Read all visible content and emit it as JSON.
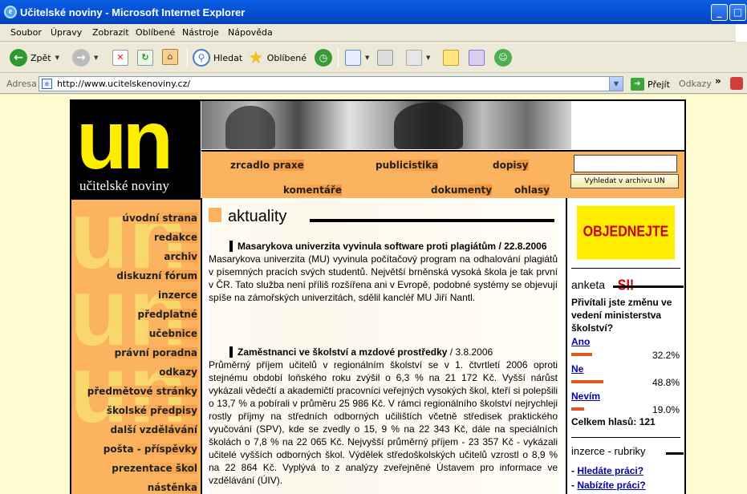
{
  "window": {
    "title": "Učitelské noviny - Microsoft Internet Explorer"
  },
  "menu": [
    "Soubor",
    "Úpravy",
    "Zobrazit",
    "Oblíbené",
    "Nástroje",
    "Nápověda"
  ],
  "toolbar": {
    "back": "Zpět",
    "search": "Hledat",
    "favorites": "Oblíbené"
  },
  "address": {
    "label": "Adresa",
    "url": "http://www.ucitelskenoviny.cz/",
    "go": "Přejít",
    "links": "Odkazy"
  },
  "logo": {
    "mark": "un",
    "name": "učitelské noviny"
  },
  "nav": {
    "items": [
      "zrcadlo praxe",
      "publicistika",
      "dopisy",
      "komentáře",
      "dokumenty",
      "ohlasy"
    ]
  },
  "search": {
    "button": "Vyhledat v archivu UN"
  },
  "sidebar": {
    "items": [
      "úvodní strana",
      "redakce",
      "archiv",
      "diskuzní fórum",
      "inzerce",
      "předplatné",
      "učebnice",
      "právní poradna",
      "odkazy",
      "předmětové stránky",
      "školské předpisy",
      "další vzdělávání",
      "pošta - příspěvky",
      "prezentace škol",
      "nástěnka"
    ]
  },
  "main": {
    "section": "aktuality",
    "articles": [
      {
        "headline": "Masarykova univerzita vyvinula software proti plagiátům",
        "date": "/ 22.8.2006",
        "body": "Masarykova univerzita (MU) vyvinula počítačový program na odhalování plagiátů v písemných pracích svých studentů. Největší brněnská vysoká škola je tak první v ČR. Tato služba není příliš rozšířena ani v Evropě, podobné systémy se objevují spíše na zámořských univerzitách, sdělil kancléř MU Jiří Nantl."
      },
      {
        "headline": "Zaměstnanci ve školství a mzdové prostředky",
        "date": "/ 3.8.2006",
        "body": "Průměrný příjem učitelů v regionálním školství se v 1. čtvrtletí 2006 oproti stejnému období loňského roku zvýšil o 6,3 % na 21 172 Kč. Vyšší nárůst vykázali vědečtí a akademičtí pracovníci veřejných vysokých škol, kteří si polepšili o 13,7 % a pobírali v průměru 25 986 Kč. V rámci regionálního školství nejrychleji rostly příjmy na středních odborných učilištích včetně středisek praktického vyučování (SPV), kde se zvedly o 15, 9 % na 22 343 Kč, dále na speciálních školách o 7,8 % na 22 065 Kč. Nejvyšší průměrný příjem - 23 357 Kč - vykázali učitelé vyšších odborných škol. Výdělek středoškolských učitelů vzrostl o 8,9 % na 22 864 Kč. Vyplývá to z analýzy zveřejněné Ústavem pro informace ve vzdělávání (ÚIV)."
      }
    ]
  },
  "right": {
    "order": "OBJEDNEJTE SI!",
    "poll": {
      "title": "anketa",
      "question": "Přivítali jste změnu ve vedení ministerstva školství?",
      "options": [
        {
          "label": "Ano",
          "percent": "32.2%",
          "share": 0.322
        },
        {
          "label": "Ne",
          "percent": "48.8%",
          "share": 0.488
        },
        {
          "label": "Nevím",
          "percent": "19.0%",
          "share": 0.19
        }
      ],
      "total": "Celkem hlasů: 121"
    },
    "ads": {
      "title": "inzerce - rubriky",
      "links": [
        "Hledáte práci?",
        "Nabízíte práci?"
      ]
    }
  },
  "colors": {
    "accent": "#fcb35f",
    "logo_yellow": "#ffed00",
    "page_bg": "#fffbd0",
    "link": "#0000aa",
    "poll_bar": "#e05a1e"
  }
}
